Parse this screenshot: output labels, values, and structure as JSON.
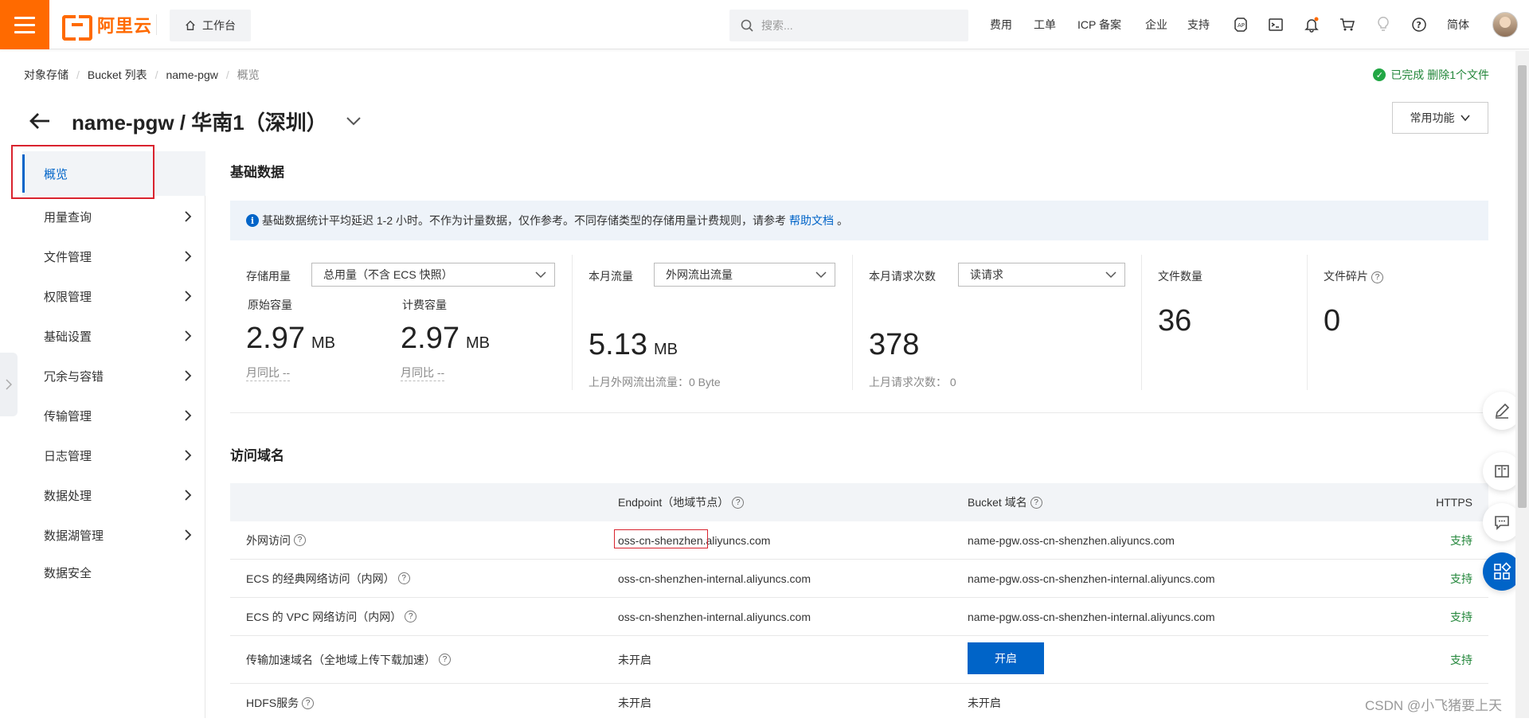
{
  "topbar": {
    "logo_text": "阿里云",
    "workbench": "工作台",
    "search_placeholder": "搜索...",
    "nav": [
      "费用",
      "工单",
      "ICP 备案",
      "企业",
      "支持"
    ],
    "lang": "简体",
    "icons": [
      "api-icon",
      "terminal-icon",
      "bell-icon",
      "cart-icon",
      "bulb-icon",
      "help-icon"
    ],
    "accent": "#ff6a00"
  },
  "breadcrumb": [
    "对象存储",
    "Bucket 列表",
    "name-pgw",
    "概览"
  ],
  "status_text": "已完成 删除1个文件",
  "title": "name-pgw / 华南1（深圳）",
  "common_functions": "常用功能",
  "sidebar": {
    "items": [
      {
        "label": "概览",
        "active": true,
        "has_arrow": false
      },
      {
        "label": "用量查询",
        "has_arrow": true
      },
      {
        "label": "文件管理",
        "has_arrow": true
      },
      {
        "label": "权限管理",
        "has_arrow": true
      },
      {
        "label": "基础设置",
        "has_arrow": true
      },
      {
        "label": "冗余与容错",
        "has_arrow": true
      },
      {
        "label": "传输管理",
        "has_arrow": true
      },
      {
        "label": "日志管理",
        "has_arrow": true
      },
      {
        "label": "数据处理",
        "has_arrow": true
      },
      {
        "label": "数据湖管理",
        "has_arrow": true
      },
      {
        "label": "数据安全",
        "has_arrow": false
      }
    ]
  },
  "basic_data": {
    "title": "基础数据",
    "notice": "基础数据统计平均延迟 1-2 小时。不作为计量数据，仅作参考。不同存储类型的存储用量计费规则，请参考",
    "notice_link": "帮助文档",
    "notice_end": "。",
    "storage": {
      "label": "存储用量",
      "select": "总用量（不含 ECS 快照）",
      "raw_label": "原始容量",
      "raw_value": "2.97",
      "raw_unit": "MB",
      "raw_mom": "月同比 --",
      "bill_label": "计费容量",
      "bill_value": "2.97",
      "bill_unit": "MB",
      "bill_mom": "月同比 --"
    },
    "traffic": {
      "label": "本月流量",
      "select": "外网流出流量",
      "value": "5.13",
      "unit": "MB",
      "last": "上月外网流出流量：0 Byte"
    },
    "requests": {
      "label": "本月请求次数",
      "select": "读请求",
      "value": "378",
      "last": "上月请求次数：  0"
    },
    "files": {
      "label": "文件数量",
      "value": "36"
    },
    "fragments": {
      "label": "文件碎片",
      "value": "0"
    }
  },
  "access": {
    "title": "访问域名",
    "headers": [
      "",
      "Endpoint（地域节点）",
      "Bucket 域名",
      "HTTPS"
    ],
    "rows": [
      {
        "name": "外网访问",
        "endpoint_prefix": "oss-cn-shenzhen",
        "endpoint_suffix": ".aliyuncs.com",
        "bucket": "name-pgw.oss-cn-shenzhen.aliyuncs.com",
        "https": "支持"
      },
      {
        "name": "ECS 的经典网络访问（内网）",
        "endpoint": "oss-cn-shenzhen-internal.aliyuncs.com",
        "bucket": "name-pgw.oss-cn-shenzhen-internal.aliyuncs.com",
        "https": "支持"
      },
      {
        "name": "ECS 的 VPC 网络访问（内网）",
        "endpoint": "oss-cn-shenzhen-internal.aliyuncs.com",
        "bucket": "name-pgw.oss-cn-shenzhen-internal.aliyuncs.com",
        "https": "支持"
      },
      {
        "name": "传输加速域名（全地域上传下载加速）",
        "endpoint": "未开启",
        "button": "开启",
        "https": "支持"
      },
      {
        "name": "HDFS服务",
        "endpoint": "未开启",
        "bucket": "未开启",
        "https": ""
      }
    ]
  },
  "watermark": "CSDN @小飞猪要上天",
  "colors": {
    "primary": "#0064c8",
    "success": "#22863a",
    "highlight": "#d9232e"
  }
}
